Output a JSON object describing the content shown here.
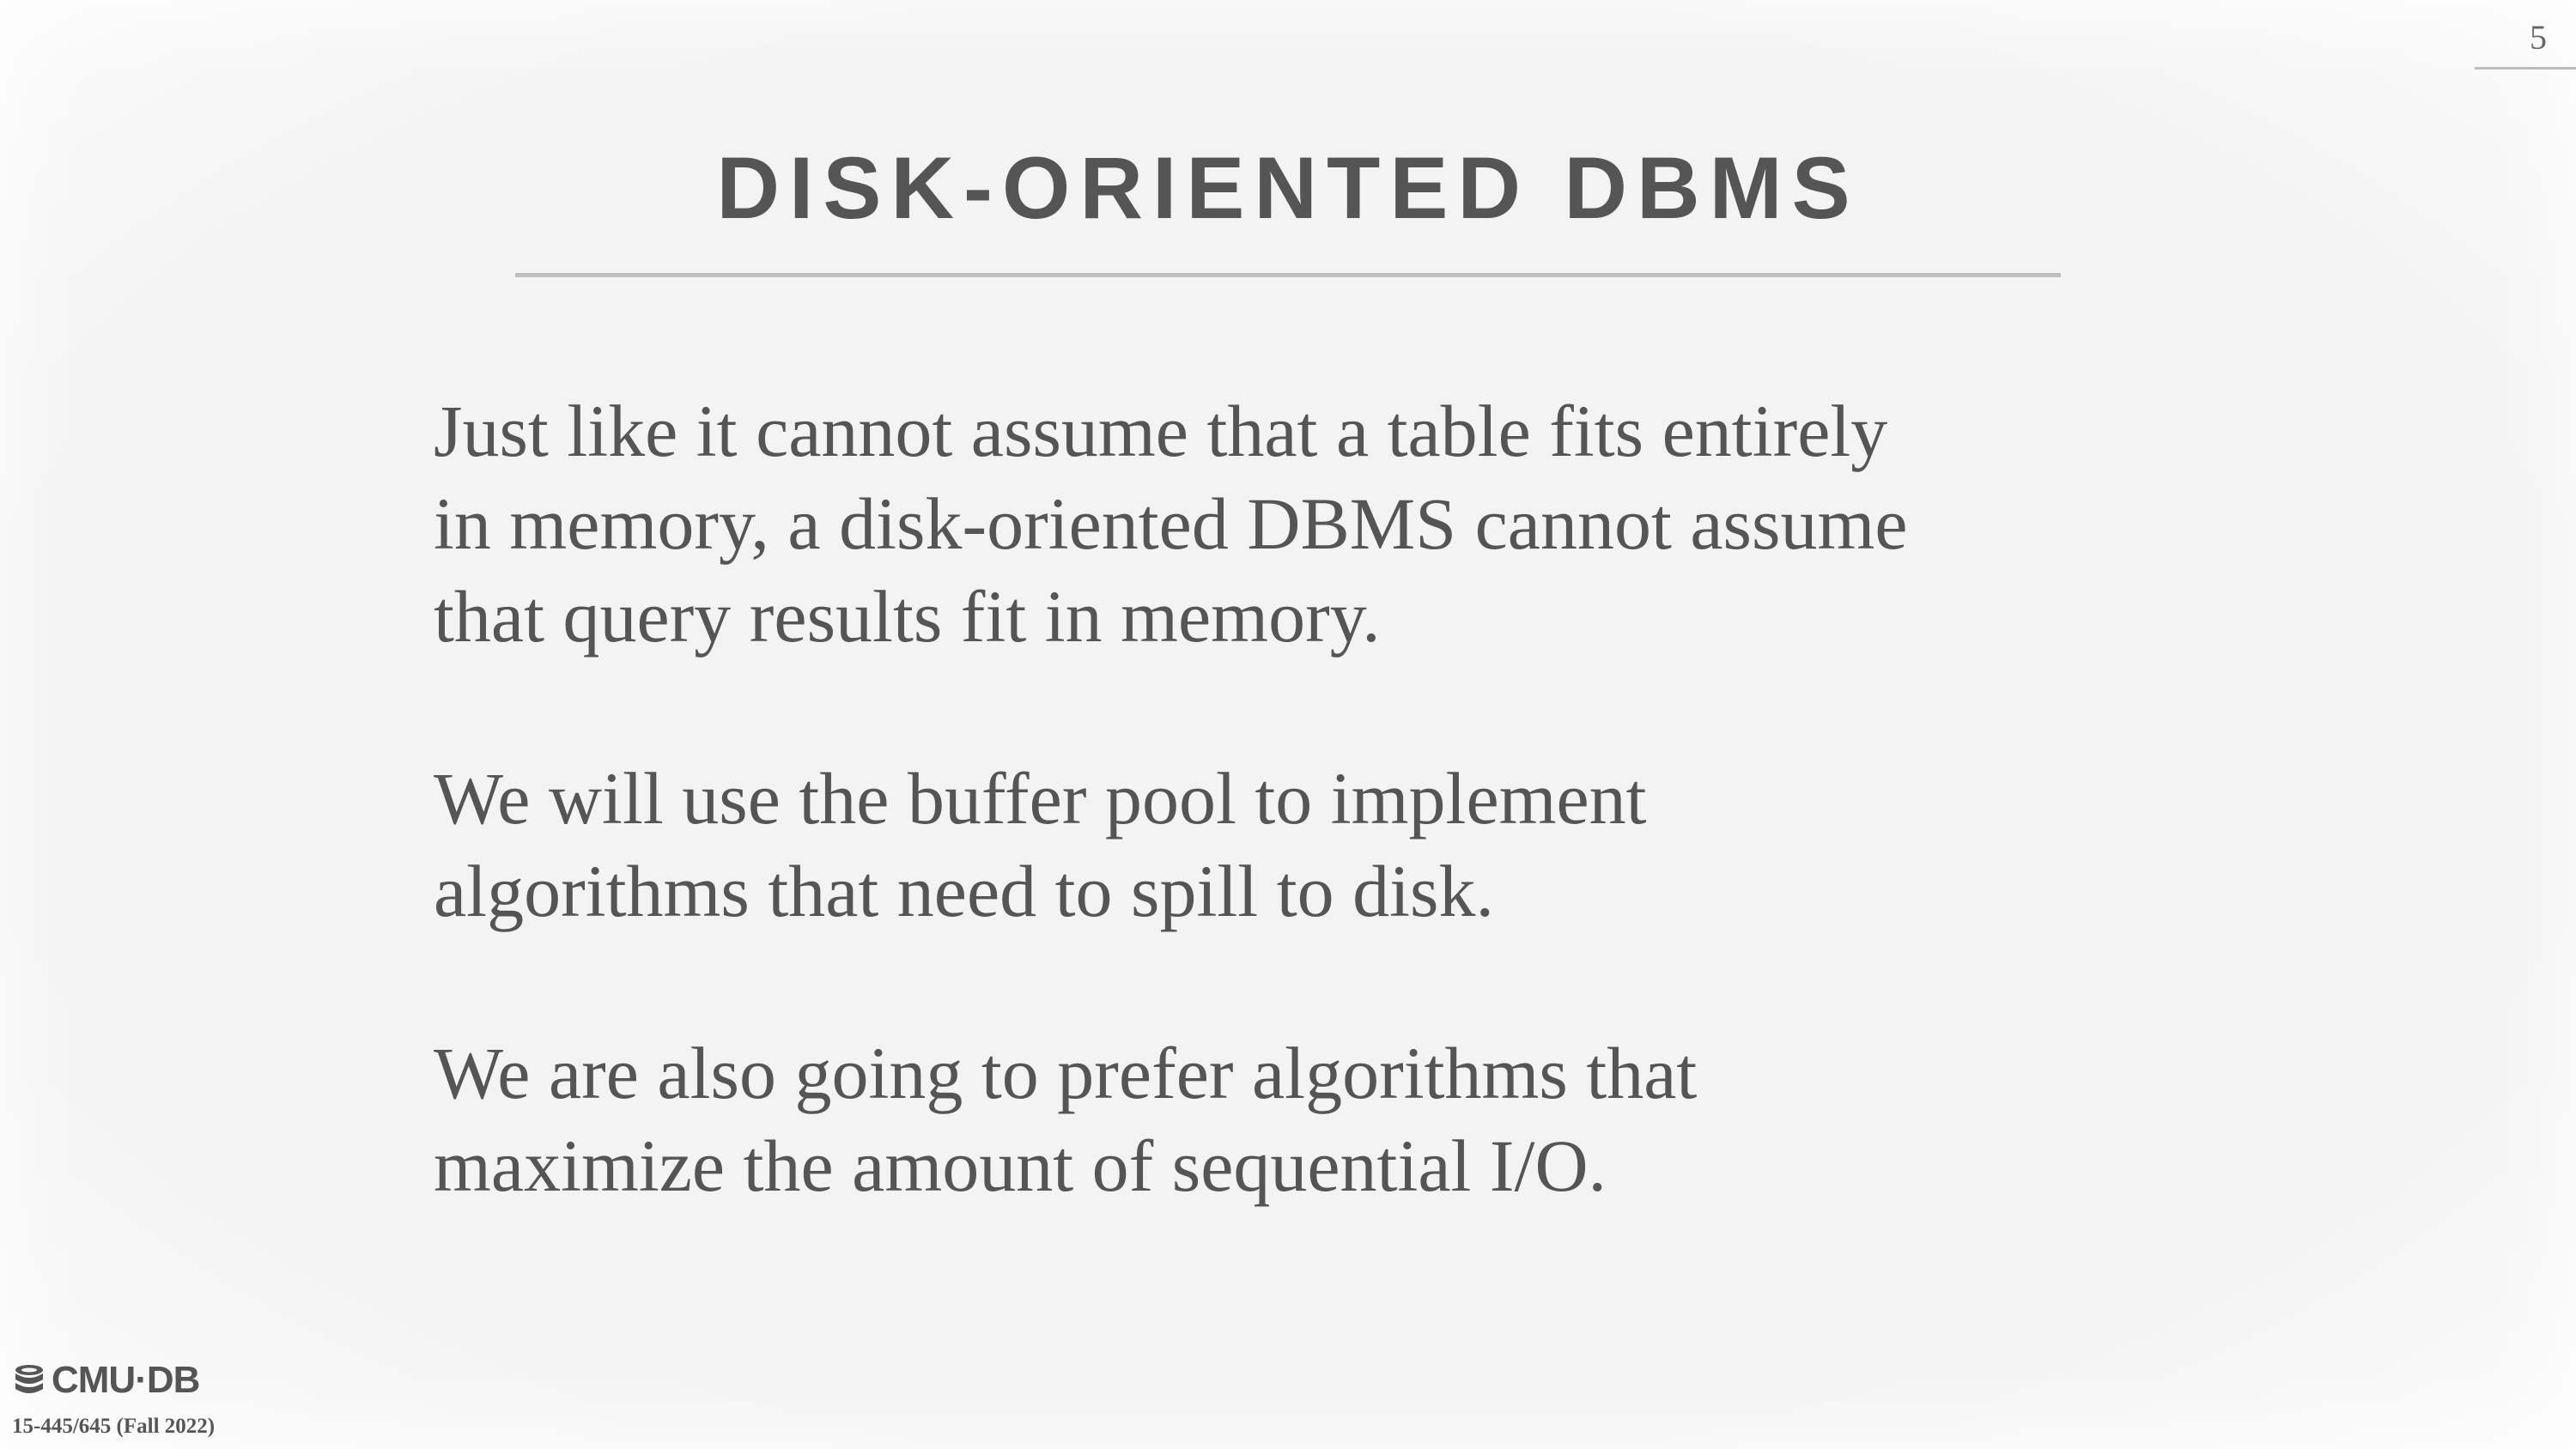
{
  "slide": {
    "page_number": "5",
    "title": "DISK-ORIENTED DBMS",
    "paragraphs": [
      "Just like it cannot assume that a table fits entirely\nin memory, a disk-oriented DBMS cannot assume\nthat query results fit in memory.",
      "We will use the buffer pool to implement\nalgorithms that need to spill to disk.",
      "We are also going to prefer algorithms that\nmaximize the amount of sequential I/O."
    ]
  },
  "footer": {
    "logo_text": "CMU·DB",
    "logo_icon": "database-icon",
    "course": "15-445/645 (Fall 2022)"
  },
  "colors": {
    "background": "#f3f3f3",
    "text": "#555555",
    "rule": "#bfbfbf"
  }
}
